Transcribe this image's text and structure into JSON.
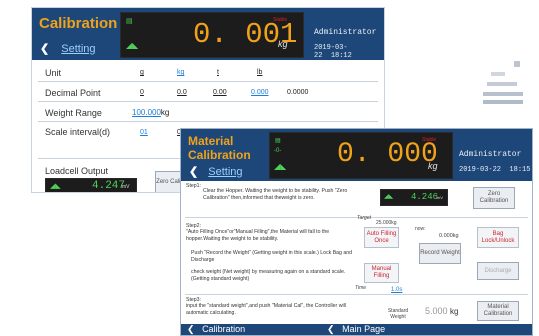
{
  "back_screen": {
    "title": "Calibration",
    "back_label": "Setting",
    "weight_value": "0. 001",
    "weight_unit": "kg",
    "stable_tag": "Stable",
    "user": "Administrator",
    "date": "2019-03-22",
    "time": "18:12",
    "rows": [
      {
        "label": "Unit",
        "options": [
          "g",
          "kg",
          "t",
          "lb"
        ]
      },
      {
        "label": "Decimal Point",
        "options": [
          "0",
          "0.0",
          "0.00",
          "0.000",
          "0.0000"
        ]
      },
      {
        "label": "Weight Range",
        "value": "100.000",
        "unit": "kg"
      },
      {
        "label": "Scale interval(d)",
        "options": [
          "01",
          "02",
          "05",
          "10",
          "20",
          "50"
        ]
      }
    ],
    "loadcell_label": "Loadcell Output",
    "loadcell_value": "4.247",
    "loadcell_unit": "mV",
    "zero_button_label": "Zero Calibration",
    "bottom_back_label": "Calibration"
  },
  "front_screen": {
    "title_line1": "Material",
    "title_line2": "Calibration",
    "back_label": "Setting",
    "weight_value": "0. 000",
    "weight_unit": "kg",
    "stable_tag": "Stable",
    "user": "Administrator",
    "date": "2019-03-22",
    "time": "18:15",
    "step1_title": "Step1:",
    "step1_text": "Clear the Hopper. Waiting the weight to be stability. Push \"Zero Calibration\" then,informed that theweight is zero.",
    "mini_value": "4.246",
    "mini_unit": "mV",
    "zero_button_label": "Zero Calibration",
    "step2_title": "Step2:",
    "step2_text1": "\"Auto Filling Once\"or\"Manual Filling\",the Material will fall to the hopper.Waiting the weight to be stability.",
    "step2_text2": "Push \"Record the Weight\" (Getting weight in this scale.) Lock Bag and Discharge",
    "step2_text3": "check weight (Net weight) by measuring again on a standard scale.(Getting standard weight)",
    "target_label": "Target",
    "target_value": "25.000kg",
    "now_label": "now:",
    "now_value": "0.000kg",
    "auto_fill_label": "Auto Filling Once",
    "record_weight_label": "Record Weight",
    "bag_lock_label": "Bag Lock/Unlock",
    "manual_fill_label": "Manual Filling",
    "discharge_label": "Discharge",
    "time_label": "Time",
    "time_value": "1.0s",
    "step3_title": "Step3:",
    "step3_text": "input the \"standard weight\",and push \"Material Cal\", the Controller will automatic calculating.",
    "standard_weight_label": "Standard Weight",
    "standard_weight_value": "5.000",
    "standard_weight_unit": "kg",
    "material_cal_label": "Material Calibration",
    "footer_back": "Calibration",
    "footer_main": "Main Page"
  }
}
